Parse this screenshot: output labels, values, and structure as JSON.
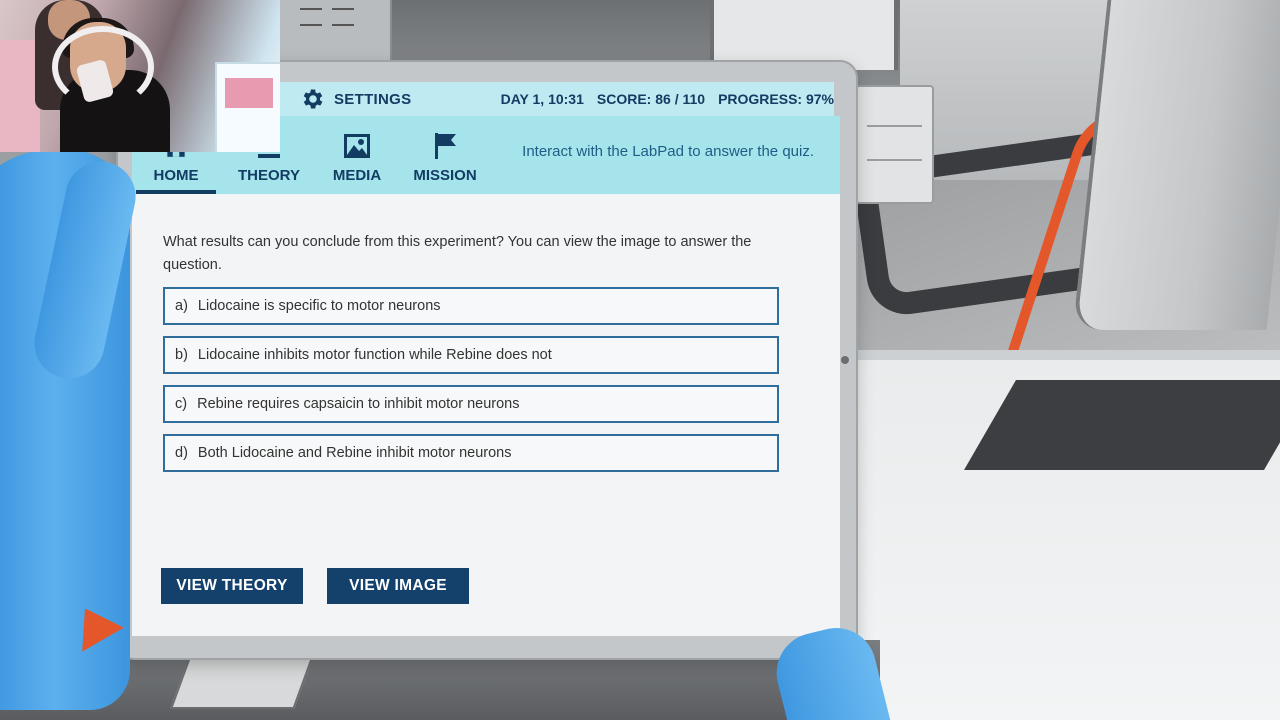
{
  "topbar": {
    "settings_label": "SETTINGS",
    "day_time": "DAY 1, 10:31",
    "score": "SCORE: 86 / 110",
    "progress": "PROGRESS: 97%"
  },
  "nav": {
    "tabs": [
      {
        "label": "HOME",
        "icon": "home-icon",
        "active": true
      },
      {
        "label": "THEORY",
        "icon": "microscope-icon",
        "active": false
      },
      {
        "label": "MEDIA",
        "icon": "image-icon",
        "active": false
      },
      {
        "label": "MISSION",
        "icon": "flag-icon",
        "active": false
      }
    ],
    "hint": "Interact with the LabPad to answer the quiz."
  },
  "quiz": {
    "question": "What results can you conclude from this experiment? You can view the image to answer the question.",
    "options": [
      {
        "key": "a)",
        "text": "Lidocaine is specific to motor neurons"
      },
      {
        "key": "b)",
        "text": "Lidocaine inhibits motor function while Rebine does not"
      },
      {
        "key": "c)",
        "text": "Rebine requires capsaicin to inhibit motor neurons"
      },
      {
        "key": "d)",
        "text": "Both Lidocaine and Rebine inhibit motor neurons"
      }
    ]
  },
  "buttons": {
    "view_theory": "VIEW THEORY",
    "view_image": "VIEW IMAGE"
  },
  "colors": {
    "accent_dark": "#133c63",
    "topbar_bg": "#bfeaf1",
    "nav_bg": "#a6e4ec",
    "button_bg": "#14416c",
    "option_border": "#2f6d9c",
    "glove": "#4aa3e6",
    "floor_stripe": "#e4572a"
  }
}
